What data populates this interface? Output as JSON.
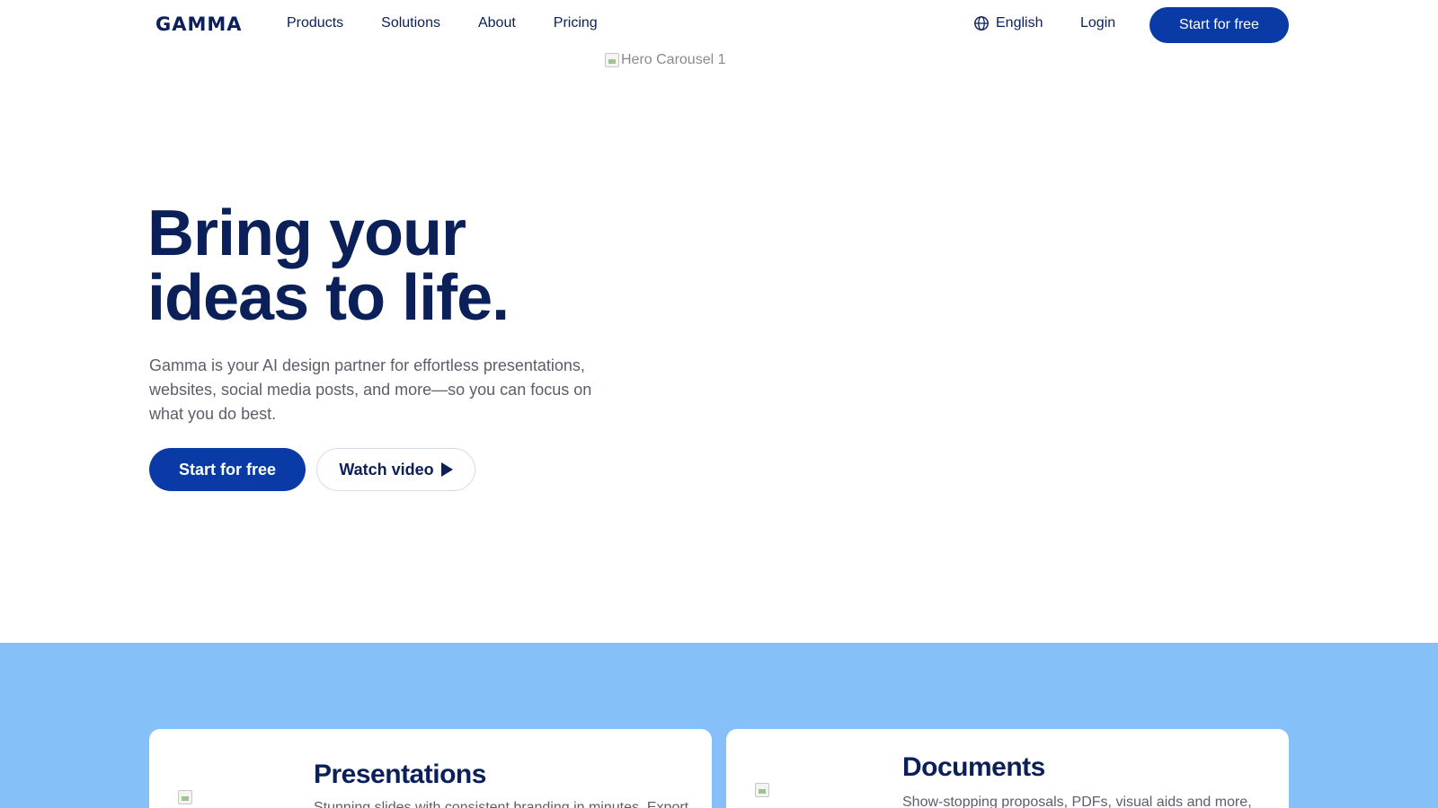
{
  "nav": {
    "logo": "GAMMA",
    "links": [
      "Products",
      "Solutions",
      "About",
      "Pricing"
    ],
    "language": "English",
    "login": "Login",
    "cta": "Start for free"
  },
  "hero": {
    "image_alt": "Hero Carousel 1",
    "title_line1": "Bring your",
    "title_line2": "ideas to life.",
    "subtitle": "Gamma is your AI design partner for effortless presentations, websites, social media posts, and more—so you can focus on what you do best.",
    "primary_cta": "Start for free",
    "secondary_cta": "Watch video"
  },
  "features": {
    "background_color": "#85c0f8",
    "cards": [
      {
        "title": "Presentations",
        "description": "Stunning slides with consistent branding in minutes. Export"
      },
      {
        "title": "Documents",
        "description": "Show-stopping proposals, PDFs, visual aids and more,"
      }
    ]
  },
  "colors": {
    "brand_navy": "#0b2059",
    "brand_blue": "#0a3aa5",
    "text_gray": "#5b5e6b"
  }
}
